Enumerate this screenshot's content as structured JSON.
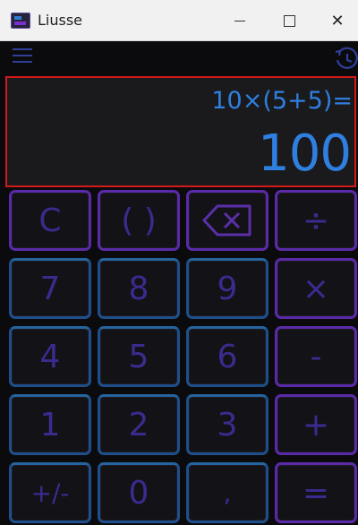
{
  "window": {
    "title": "Liusse",
    "minimize_glyph": "",
    "maximize_glyph": "",
    "close_glyph": "✕"
  },
  "display": {
    "expression": "10×(5+5)=",
    "result": "100"
  },
  "keypad": {
    "keys": [
      {
        "label": "C"
      },
      {
        "label": "( )"
      },
      {
        "label": ""
      },
      {
        "label": "÷"
      },
      {
        "label": "7"
      },
      {
        "label": "8"
      },
      {
        "label": "9"
      },
      {
        "label": "×"
      },
      {
        "label": "4"
      },
      {
        "label": "5"
      },
      {
        "label": "6"
      },
      {
        "label": "-"
      },
      {
        "label": "1"
      },
      {
        "label": "2"
      },
      {
        "label": "3"
      },
      {
        "label": "+"
      },
      {
        "label": "+∕-"
      },
      {
        "label": "0"
      },
      {
        "label": ","
      },
      {
        "label": "="
      }
    ]
  },
  "colors": {
    "display_text": "#2f7fe0",
    "display_border": "#d11a1a",
    "key_text": "#3d2a8f",
    "key_border_purple": "#5a2aa8",
    "key_border_blue": "#1f4f8a"
  },
  "icons": {
    "menu": "hamburger-icon",
    "history": "history-icon",
    "backspace": "backspace-icon"
  }
}
